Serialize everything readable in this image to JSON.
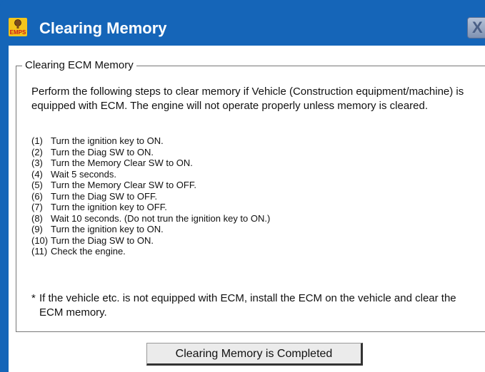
{
  "window": {
    "title": "Clearing Memory",
    "icon_text": "EMPS",
    "close_label": "X"
  },
  "group": {
    "label": "Clearing ECM Memory",
    "intro": "Perform the following steps to clear memory if Vehicle (Construction equipment/machine) is equipped with ECM.  The engine will not operate properly unless memory is cleared.",
    "steps": [
      {
        "num": "(1)",
        "text": "Turn the ignition key to ON."
      },
      {
        "num": "(2)",
        "text": "Turn the Diag SW to ON."
      },
      {
        "num": "(3)",
        "text": "Turn the Memory Clear SW to ON."
      },
      {
        "num": "(4)",
        "text": "Wait 5 seconds."
      },
      {
        "num": "(5)",
        "text": "Turn the Memory Clear SW to OFF."
      },
      {
        "num": "(6)",
        "text": "Turn the Diag SW to OFF."
      },
      {
        "num": "(7)",
        "text": "Turn the ignition key to OFF."
      },
      {
        "num": "(8)",
        "text": "Wait 10 seconds. (Do not trun the ignition key to ON.)"
      },
      {
        "num": "(9)",
        "text": "Turn the ignition key to ON."
      },
      {
        "num": "(10)",
        "text": "Turn the Diag SW to ON."
      },
      {
        "num": "(11)",
        "text": "Check the engine."
      }
    ],
    "note_marker": "*",
    "note": "If the vehicle etc. is not equipped with ECM, install the ECM on the vehicle and clear the ECM memory."
  },
  "buttons": {
    "completed": "Clearing Memory is Completed"
  },
  "colors": {
    "titlebar": "#1565b8",
    "icon_bg": "#f3c51b",
    "icon_text": "#d0161b"
  }
}
